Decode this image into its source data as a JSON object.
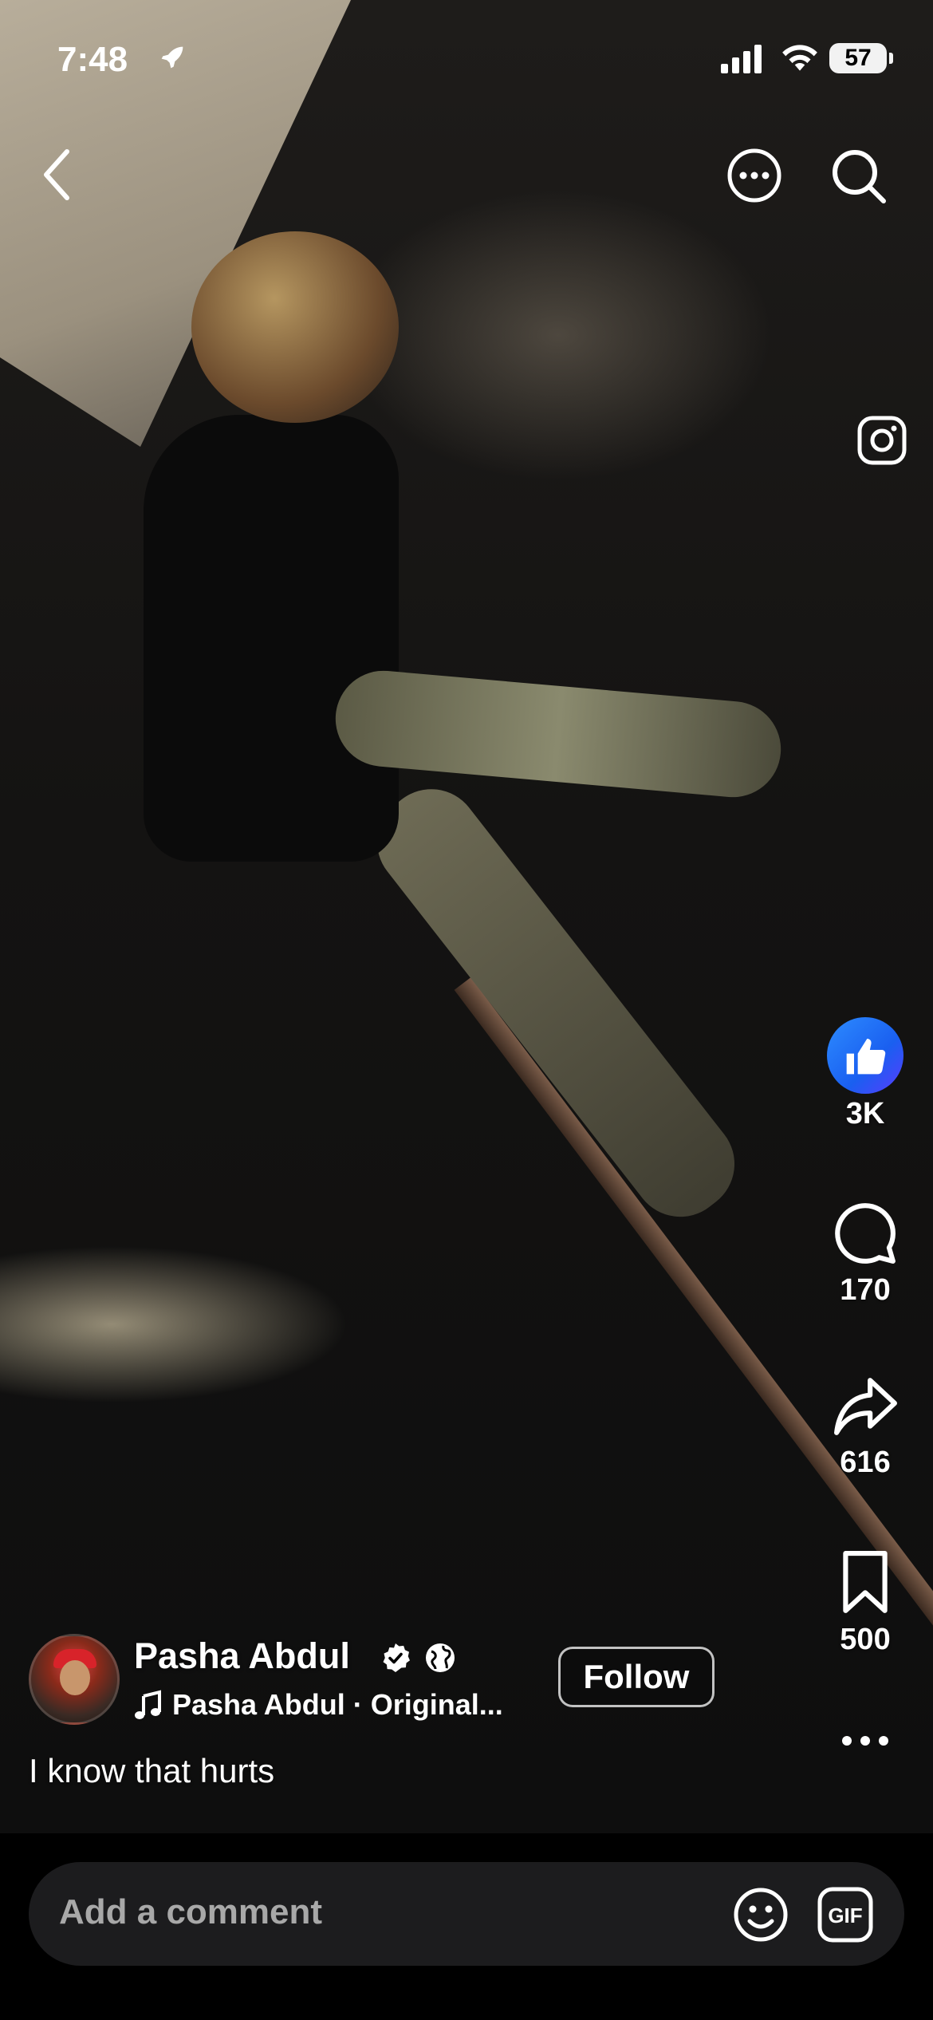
{
  "status_bar": {
    "time": "7:48",
    "battery": "57"
  },
  "post": {
    "author": "Pasha Abdul",
    "audio": "Pasha Abdul · Original...",
    "follow_label": "Follow",
    "caption": "I know that hurts"
  },
  "actions": {
    "likes": "3K",
    "comments": "170",
    "shares": "616",
    "saves": "500"
  },
  "comment_bar": {
    "placeholder": "Add a comment"
  },
  "colors": {
    "like_blue": "#1a5ff0",
    "background": "#000000",
    "comment_field": "#1c1c1e"
  },
  "icons": [
    "rocket-icon",
    "signal-icon",
    "wifi-icon",
    "battery-icon",
    "back-icon",
    "more-icon",
    "search-icon",
    "instagram-icon",
    "like-icon",
    "comment-icon",
    "share-icon",
    "bookmark-icon",
    "verified-icon",
    "globe-icon",
    "music-note-icon",
    "emoji-icon",
    "gif-icon",
    "more-dots-icon"
  ]
}
